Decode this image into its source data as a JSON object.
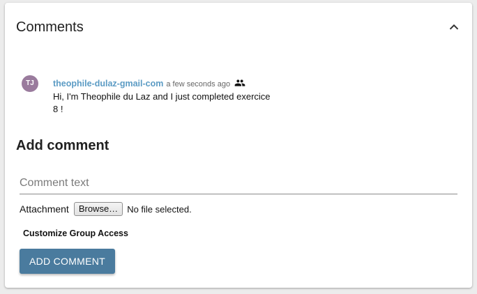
{
  "panel": {
    "title": "Comments",
    "collapse_icon": "chevron-up-icon"
  },
  "comments": [
    {
      "avatar_initials": "TJ",
      "avatar_color": "#9a7b9d",
      "author": "theophile-dulaz-gmail-com",
      "timestamp": "a few seconds ago",
      "visibility_icon": "group-icon",
      "text": "Hi, I'm Theophile du Laz and I just completed exercice 8 !"
    }
  ],
  "add_comment": {
    "title": "Add comment",
    "text_placeholder": "Comment text",
    "text_value": "",
    "attachment_label": "Attachment",
    "browse_label": "Browse…",
    "file_status": "No file selected.",
    "customize_access_label": "Customize Group Access",
    "submit_label": "ADD COMMENT"
  },
  "colors": {
    "author_link": "#5b9bc4",
    "primary_button": "#4a7b9e"
  }
}
